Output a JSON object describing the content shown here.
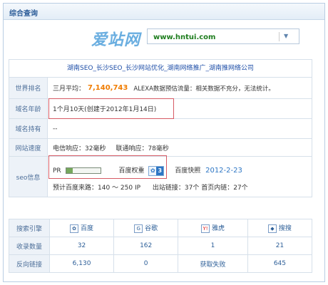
{
  "panel": {
    "title": "综合查询"
  },
  "logo": {
    "text": "爱站网"
  },
  "search": {
    "domain": "www.hntui.com",
    "dropdown_icon": "chevron-down-icon"
  },
  "site": {
    "title": "湖南SEO_长沙SEO_长沙网站优化_湖南网络推广_湖南推网络公司"
  },
  "rows": {
    "world_rank": {
      "label": "世界排名",
      "text1": "三月平均：",
      "value": "7,140,743",
      "text2": "ALEXA数据预估流量：相关数据不充分，无法统计。"
    },
    "domain_age": {
      "label": "域名年龄",
      "value": "1个月10天(创建于2012年1月14日)"
    },
    "domain_holder": {
      "label": "域名持有",
      "value": "--"
    },
    "speed": {
      "label": "网站速度",
      "telecom": "电信响应：32毫秒",
      "unicom": "联通响应：78毫秒"
    },
    "seo": {
      "label": "seo信息",
      "pr_label": "PR",
      "pr_value": 2,
      "pr_max": 10,
      "baidu_weight_label": "百度权重",
      "baidu_weight_value": "3",
      "snapshot_label": "百度快照",
      "snapshot_date": "2012-2-23",
      "traffic": "预计百度来路：140 ～ 250 IP",
      "outbound": "出站链接：37个 首页内链：27个"
    }
  },
  "engines": {
    "header_label": "搜索引擎",
    "names": [
      "百度",
      "谷歌",
      "雅虎",
      "搜搜"
    ],
    "icons": [
      "baidu-icon",
      "google-icon",
      "yahoo-icon",
      "soso-icon"
    ],
    "rows": [
      {
        "label": "收录数量",
        "values": [
          "32",
          "162",
          "1",
          "21"
        ]
      },
      {
        "label": "反向链接",
        "values": [
          "6,130",
          "0",
          "获取失败",
          "645"
        ]
      }
    ]
  },
  "colors": {
    "accent": "#2d76c4",
    "rank": "#f07c00",
    "highlight": "#d65a64",
    "domain": "#1e7d1e"
  }
}
